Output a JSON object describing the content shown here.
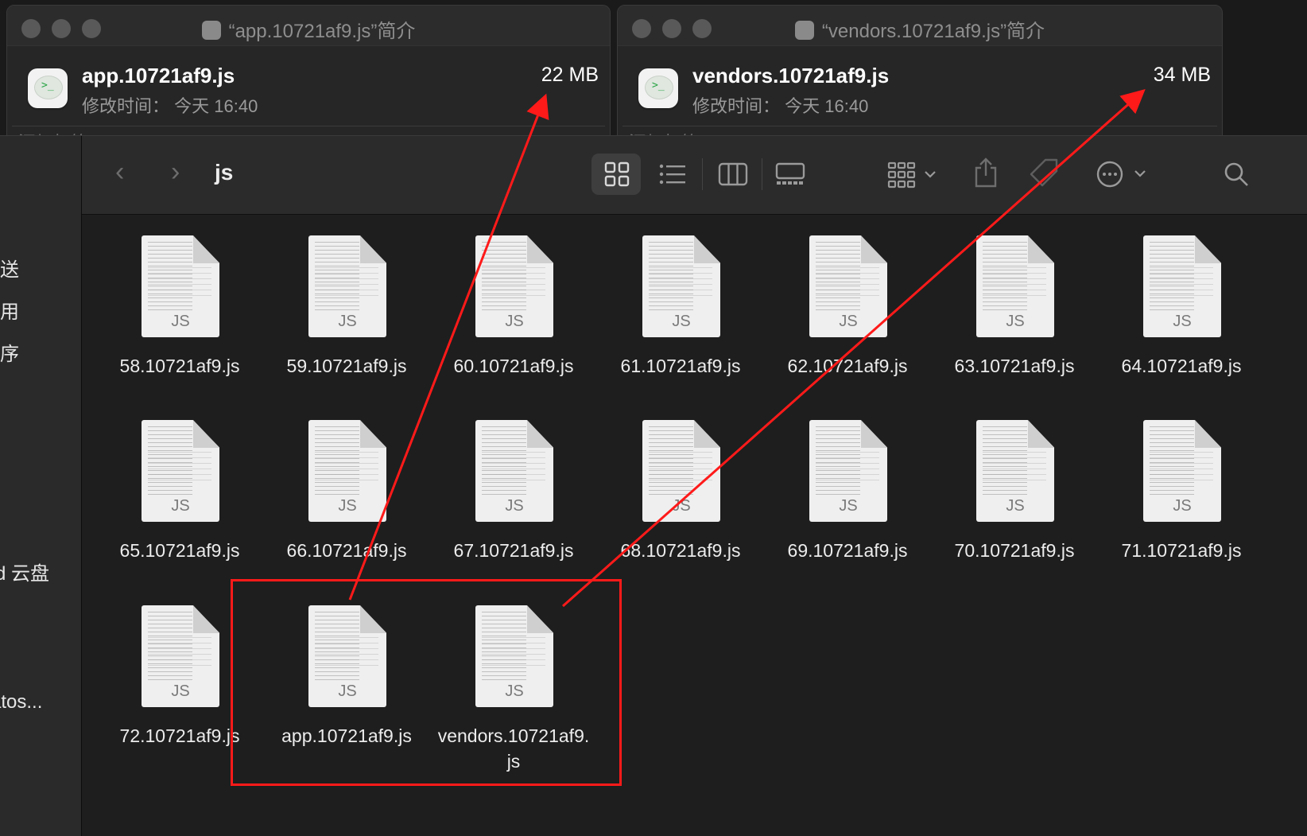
{
  "info_windows": [
    {
      "title": "“app.10721af9.js”简介",
      "file_name": "app.10721af9.js",
      "modified_label": "修改时间：",
      "modified_value": "今天 16:40",
      "size": "22 MB",
      "tags_placeholder": "添加标签…"
    },
    {
      "title": "“vendors.10721af9.js”简介",
      "file_name": "vendors.10721af9.js",
      "modified_label": "修改时间：",
      "modified_value": "今天 16:40",
      "size": "34 MB",
      "tags_placeholder": "添加标签…"
    }
  ],
  "finder": {
    "folder": "js",
    "nav_back": "‹",
    "nav_forward": "›",
    "sidebar": [
      "投送",
      "使用",
      "程序",
      "d 云盘",
      "atos..."
    ],
    "file_type_badge": "JS",
    "files": [
      "58.10721af9.js",
      "59.10721af9.js",
      "60.10721af9.js",
      "61.10721af9.js",
      "62.10721af9.js",
      "63.10721af9.js",
      "64.10721af9.js",
      "65.10721af9.js",
      "66.10721af9.js",
      "67.10721af9.js",
      "68.10721af9.js",
      "69.10721af9.js",
      "70.10721af9.js",
      "71.10721af9.js",
      "72.10721af9.js",
      "app.10721af9.js",
      "vendors.10721af9.\njs"
    ],
    "toolbar_icons": [
      "icon-view-icon",
      "list-view-icon",
      "column-view-icon",
      "gallery-view-icon",
      "group-icon",
      "share-icon",
      "tag-icon",
      "more-icon",
      "search-icon"
    ]
  },
  "annotation_color": "#ff1a1a"
}
